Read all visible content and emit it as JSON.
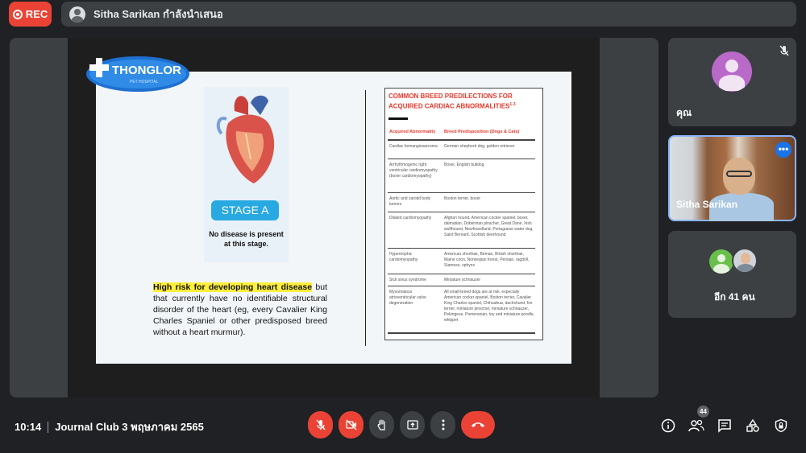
{
  "top_bar": {
    "rec_label": "REC",
    "presenter_text": "Sitha Sarikan กำลังนำเสนอ"
  },
  "slide": {
    "logo_text": "THONGLOR",
    "logo_sub": "PET HOSPITAL",
    "stage_label": "STAGE A",
    "no_disease_text": "No disease is present at this stage.",
    "highlight_text": "High risk for developing heart disease",
    "paragraph_rest": " but that currently have no identifiable structural disorder of the heart (eg, every Cavalier King Charles Spaniel or other predisposed breed without a heart murmur).",
    "table": {
      "title": "COMMON BREED PREDILECTIONS FOR ACQUIRED CARDIAC ABNORMALITIES",
      "title_sup": "1-3",
      "col1": "Acquired Abnormality",
      "col2": "Breed Predisposition (Dogs & Cats)",
      "rows": [
        {
          "a": "Cardiac hemangiosarcoma",
          "b": "German shepherd dog, golden retriever"
        },
        {
          "a": "Arrhythmogenic right ventricular cardiomyopathy (boxer cardiomyopathy)",
          "b": "Boxer, English bulldog"
        },
        {
          "a": "Aortic and carotid body tumors",
          "b": "Boston terrier, boxer"
        },
        {
          "a": "Dilated cardiomyopathy",
          "b": "Afghan hound, American cocker spaniel, boxer, dalmatian, Doberman pinscher, Great Dane, Irish wolfhound, Newfoundland, Portuguese water dog, Saint Bernard, Scottish deerhound"
        },
        {
          "a": "Hypertrophic cardiomyopathy",
          "b": "American shorthair, Birman, British shorthair, Maine coon, Norwegian forest, Persian, ragdoll, Siamese, sphynx"
        },
        {
          "a": "Sick sinus syndrome",
          "b": "Miniature schnauzer"
        },
        {
          "a": "Myxomatous atrioventricular valve degeneration",
          "b": "All small-breed dogs are at risk, especially American cocker spaniel, Boston terrier, Cavalier King Charles spaniel, Chihuahua, dachshund, fox terrier, miniature pinscher, miniature schnauzer, Pekingese, Pomeranian, toy and miniature poodle, whippet"
        }
      ]
    }
  },
  "sidebar": {
    "you_label": "คุณ",
    "presenter_tile_label": "Sitha Sarikan",
    "others_label": "อีก 41 คน"
  },
  "bottom": {
    "time": "10:14",
    "meeting_title": "Journal Club 3 พฤษภาคม 2565",
    "people_count": "44"
  },
  "colors": {
    "danger": "#ea4335",
    "control_grey": "#3c4043",
    "background": "#202124",
    "accent_blue": "#1a73e8"
  }
}
